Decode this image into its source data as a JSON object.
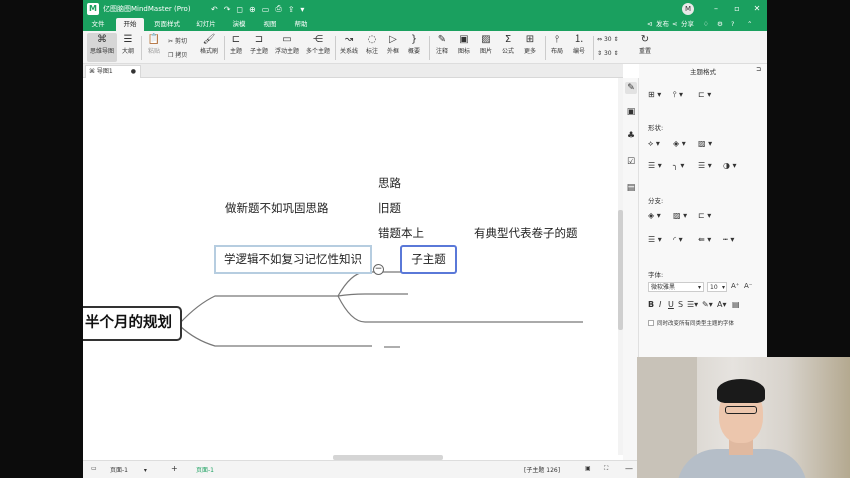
{
  "window": {
    "title": "亿图脑图MindMaster (Pro)",
    "user_initial": "M",
    "quick_icons": [
      "↶",
      "↷",
      "◻",
      "⊕",
      "▭",
      "⎙",
      "⇪",
      "▾"
    ]
  },
  "menubar": {
    "items": [
      "文件",
      "开始",
      "页面样式",
      "幻灯片",
      "演模",
      "视图",
      "帮助"
    ],
    "publish": "发布",
    "share": "分享"
  },
  "ribbon": {
    "mindmap": "思维导图",
    "outline": "大纲",
    "paste": "粘贴",
    "cut": "剪切",
    "copy": "拷贝",
    "format_painter": "格式刷",
    "topic": "主题",
    "subtopic": "子主题",
    "floating_topic": "浮动主题",
    "multi_topic": "多个主题",
    "relationship": "关系线",
    "callout": "标注",
    "boundary": "外框",
    "summary": "概要",
    "note": "注释",
    "icon": "图标",
    "image": "图片",
    "formula": "公式",
    "more": "更多",
    "layout": "布局",
    "numbering": "编号",
    "spacing_h": "30",
    "spacing_v": "30",
    "reset": "重置"
  },
  "doc_tab": {
    "label": "导图1"
  },
  "mindmap": {
    "root": "半个月的规划",
    "branch1": "做新题不如巩固思路",
    "leaf1": "思路",
    "leaf2": "旧题",
    "leaf3": "错题本上",
    "leaf3_child": "有典型代表卷子的题",
    "branch2": "学逻辑不如复习记忆性知识",
    "subtopic": "子主题",
    "collapse_symbol": "−"
  },
  "statusbar": {
    "page_select": "页面-1",
    "page_tab": "页面-1",
    "selection_info": "[子主题 126]"
  },
  "panel": {
    "title": "主题格式",
    "shape_label": "形状:",
    "branch_label": "分支:",
    "font_label": "字体:",
    "font_family": "微软雅黑",
    "font_size": "10",
    "apply_all": "同时改变所有同类型主题的字体"
  }
}
